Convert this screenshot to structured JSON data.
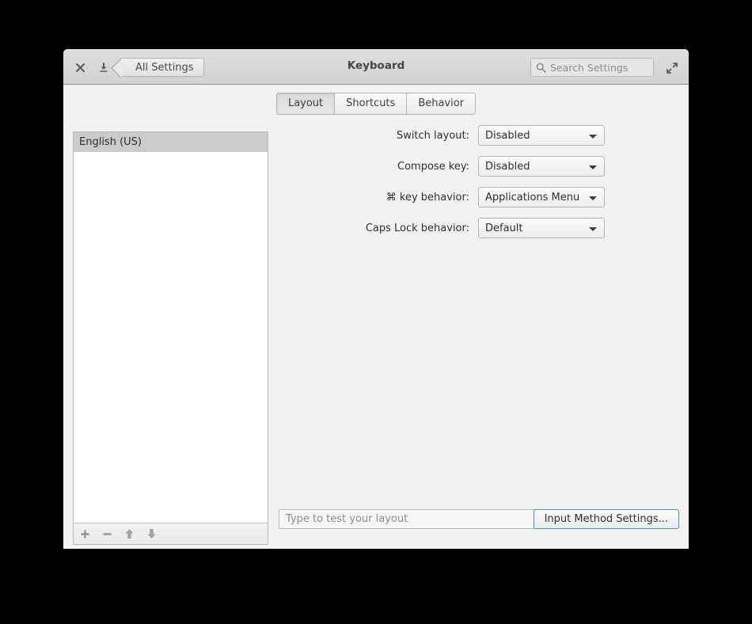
{
  "window": {
    "title": "Keyboard",
    "titlebar": {
      "close_icon": "close-icon",
      "minimize_icon": "minimize-icon",
      "maximize_icon": "maximize-icon",
      "back_button_label": "All Settings"
    },
    "search": {
      "placeholder": "Search Settings",
      "value": "",
      "icon": "search-icon"
    }
  },
  "tabs": [
    {
      "label": "Layout",
      "active": true
    },
    {
      "label": "Shortcuts",
      "active": false
    },
    {
      "label": "Behavior",
      "active": false
    }
  ],
  "layout_panel": {
    "items": [
      {
        "label": "English (US)",
        "selected": true
      }
    ],
    "toolbar": [
      {
        "name": "add-layout-button",
        "glyph": "+"
      },
      {
        "name": "remove-layout-button",
        "glyph": "−"
      },
      {
        "name": "move-layout-up-button",
        "glyph": "⬆"
      },
      {
        "name": "move-layout-down-button",
        "glyph": "⬇"
      }
    ]
  },
  "settings": {
    "rows": [
      {
        "label": "Switch layout:",
        "value": "Disabled"
      },
      {
        "label": "Compose key:",
        "value": "Disabled"
      },
      {
        "label": "⌘  key behavior:",
        "value": "Applications Menu"
      },
      {
        "label": "Caps Lock behavior:",
        "value": "Default"
      }
    ]
  },
  "bottom_bar": {
    "test_input_placeholder": "Type to test your layout",
    "test_input_value": "",
    "input_method_button_label": "Input Method Settings..."
  },
  "colors": {
    "desktop_background": "#000000",
    "window_background": "#f2f2f1",
    "titlebar": "#d6d6d4",
    "selection": "#cbcbc9",
    "focus_accent": "#4a90d9"
  }
}
